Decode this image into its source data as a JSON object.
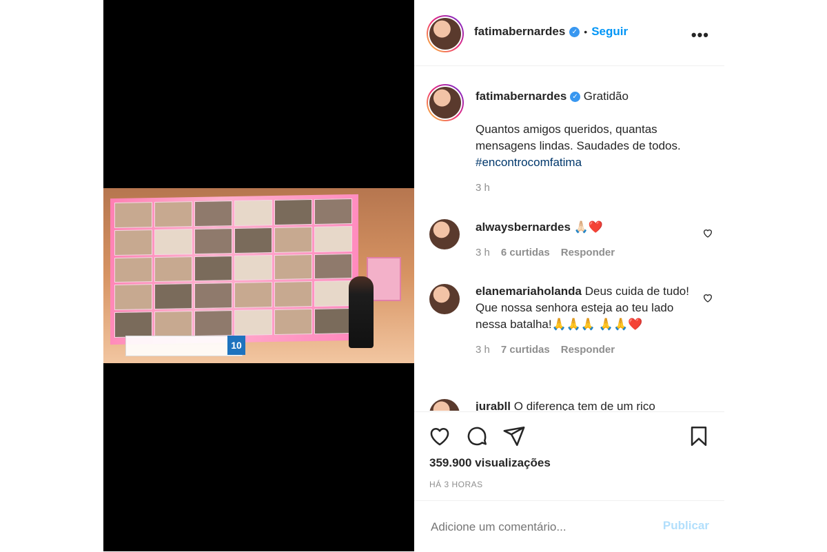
{
  "header": {
    "username": "fatimabernardes",
    "separator": "•",
    "follow_label": "Seguir",
    "more_label": "•••"
  },
  "caption": {
    "username": "fatimabernardes",
    "title": "Gratidão",
    "body": "Quantos amigos queridos, quantas mensagens lindas. Saudades de todos.",
    "hashtag": "#encontrocomfatima",
    "time": "3 h"
  },
  "comments": [
    {
      "username": "alwaysbernardes",
      "text": "🙏🏻❤️",
      "time": "3 h",
      "likes": "6 curtidas",
      "reply": "Responder"
    },
    {
      "username": "elanemariaholanda",
      "text": "Deus cuida de tudo! Que nossa senhora esteja ao teu lado nessa batalha!🙏🙏🙏 🙏🙏❤️",
      "time": "3 h",
      "likes": "7 curtidas",
      "reply": "Responder"
    },
    {
      "username": "jurabll",
      "text": "O diferença tem de um rico"
    }
  ],
  "video": {
    "ticker_number": "10"
  },
  "stats": {
    "views": "359.900 visualizações",
    "time_ago": "HÁ 3 HORAS"
  },
  "add_comment": {
    "placeholder": "Adicione um comentário...",
    "publish_label": "Publicar"
  },
  "colors": {
    "link": "#0095f6",
    "hashtag": "#00376b",
    "muted": "#8e8e8e",
    "verified": "#3897f0"
  }
}
